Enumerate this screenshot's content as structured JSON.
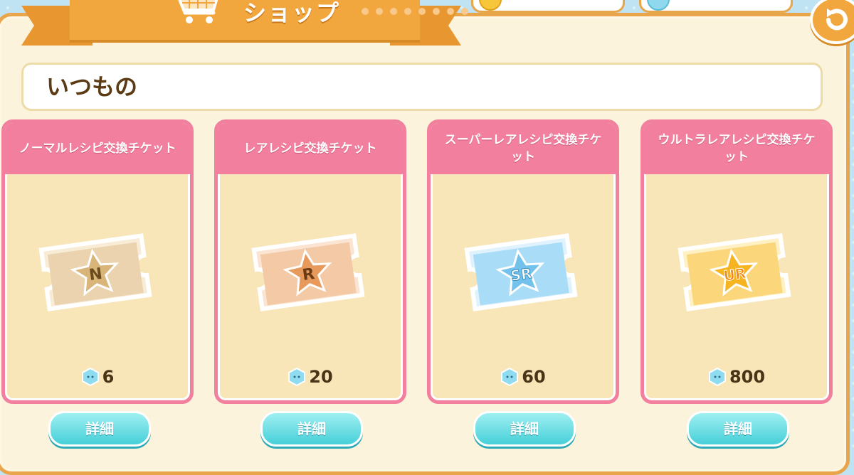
{
  "header": {
    "title": "ショップ"
  },
  "section": {
    "title": "いつもの"
  },
  "icons": {
    "cart": "shopping-cart-icon",
    "back": "back-arrow-icon",
    "currency": "gem-icon"
  },
  "colors": {
    "accent_orange": "#f2a73e",
    "card_pink": "#f27f9e",
    "button_cyan": "#46cfd8"
  },
  "cards": [
    {
      "name": "ノーマルレシピ交換チケット",
      "rank": "N",
      "price": "6",
      "detail_label": "詳細"
    },
    {
      "name": "レアレシピ交換チケット",
      "rank": "R",
      "price": "20",
      "detail_label": "詳細"
    },
    {
      "name": "スーパーレアレシピ交換チケット",
      "rank": "SR",
      "price": "60",
      "detail_label": "詳細"
    },
    {
      "name": "ウルトラレアレシピ交換チケット",
      "rank": "UR",
      "price": "800",
      "detail_label": "詳細"
    }
  ]
}
